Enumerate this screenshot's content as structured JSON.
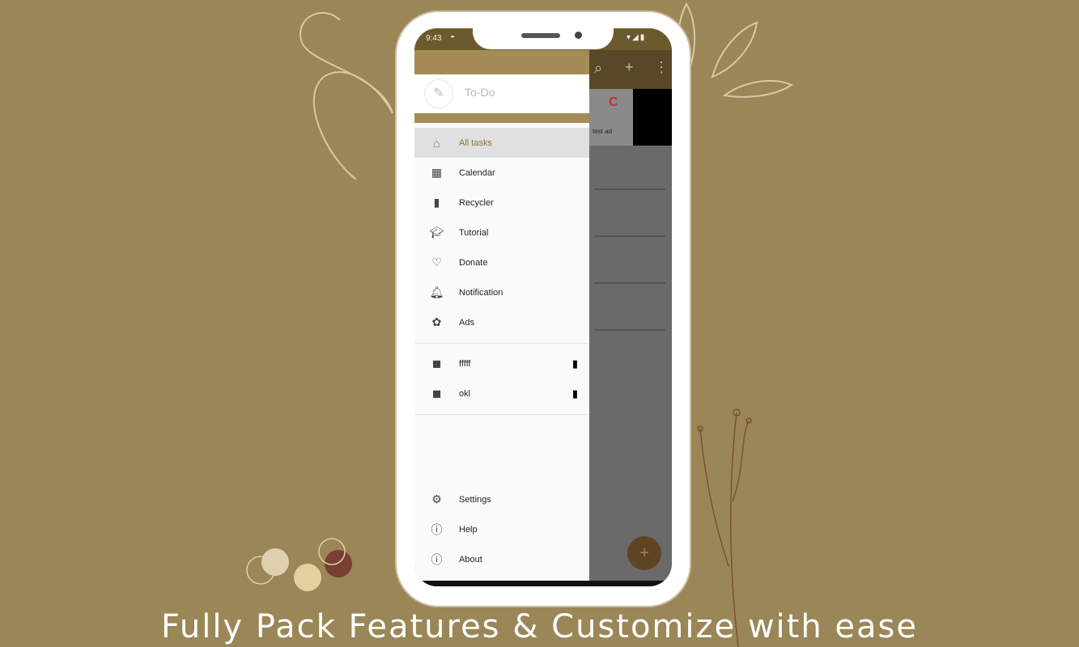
{
  "colors": {
    "background": "#9a8657",
    "accent": "#a48d55",
    "status_bar": "#6b5a2e"
  },
  "status_bar": {
    "time": "9:43"
  },
  "app": {
    "title": "To-Do",
    "logo_icon": "notepad-icon",
    "content_snippet": "test ad"
  },
  "toolbar": {
    "icons": [
      "search-icon",
      "plus-icon",
      "more-vert-icon"
    ]
  },
  "drawer": {
    "items": [
      {
        "label": "All tasks",
        "icon": "home-icon",
        "selected": true
      },
      {
        "label": "Calendar",
        "icon": "calendar-icon"
      },
      {
        "label": "Recycler",
        "icon": "trash-icon"
      },
      {
        "label": "Tutorial",
        "icon": "graduation-cap-icon"
      },
      {
        "label": "Donate",
        "icon": "donate-hand-icon"
      },
      {
        "label": "Notification",
        "icon": "bell-icon"
      },
      {
        "label": "Ads",
        "icon": "ads-icon"
      }
    ],
    "labels": [
      {
        "label": "fffff",
        "icon": "label-tag-icon"
      },
      {
        "label": "okl",
        "icon": "label-tag-icon"
      }
    ],
    "footer": [
      {
        "label": "Settings",
        "icon": "gear-icon"
      },
      {
        "label": "Help",
        "icon": "help-circle-icon"
      },
      {
        "label": "About",
        "icon": "info-icon"
      }
    ]
  },
  "caption": "Fully Pack Features & Customize with ease"
}
